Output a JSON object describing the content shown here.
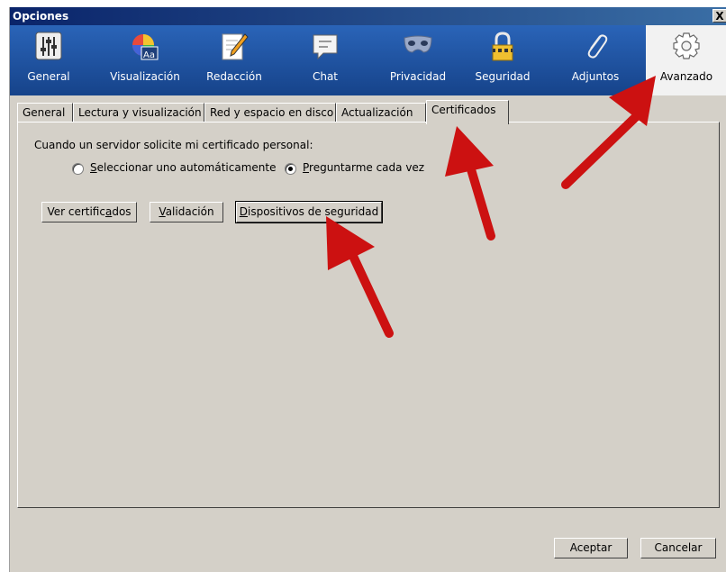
{
  "window": {
    "title": "Opciones",
    "close_label": "X"
  },
  "toolbar": {
    "items": [
      {
        "label": "General",
        "icon": "sliders-icon"
      },
      {
        "label": "Visualización",
        "icon": "color-text-icon"
      },
      {
        "label": "Redacción",
        "icon": "pencil-paper-icon"
      },
      {
        "label": "Chat",
        "icon": "speech-bubble-icon"
      },
      {
        "label": "Privacidad",
        "icon": "mask-icon"
      },
      {
        "label": "Seguridad",
        "icon": "padlock-icon"
      },
      {
        "label": "Adjuntos",
        "icon": "paperclip-icon"
      },
      {
        "label": "Avanzado",
        "icon": "gear-icon",
        "selected": true
      }
    ]
  },
  "tabs": [
    {
      "label": "General"
    },
    {
      "label": "Lectura y visualización"
    },
    {
      "label": "Red y espacio en disco"
    },
    {
      "label": "Actualización"
    },
    {
      "label": "Certificados",
      "active": true
    }
  ],
  "certificados": {
    "prompt": "Cuando un servidor solicite mi certificado personal:",
    "radio_auto_u": "S",
    "radio_auto_rest": "eleccionar uno automáticamente",
    "radio_auto_checked": false,
    "radio_ask_u": "P",
    "radio_ask_rest": "reguntarme cada vez",
    "radio_ask_checked": true,
    "btn_ver_a": "Ver certific",
    "btn_ver_u": "a",
    "btn_ver_b": "dos",
    "btn_val_u": "V",
    "btn_val_rest": "alidación",
    "btn_disp_u": "D",
    "btn_disp_rest": "ispositivos de seguridad"
  },
  "footer": {
    "accept_label": "Aceptar",
    "cancel_label": "Cancelar"
  },
  "colors": {
    "toolbar_bg": "#1a4e9c",
    "window_bg": "#d4d0c8",
    "annotation_arrow": "#cc1111"
  }
}
